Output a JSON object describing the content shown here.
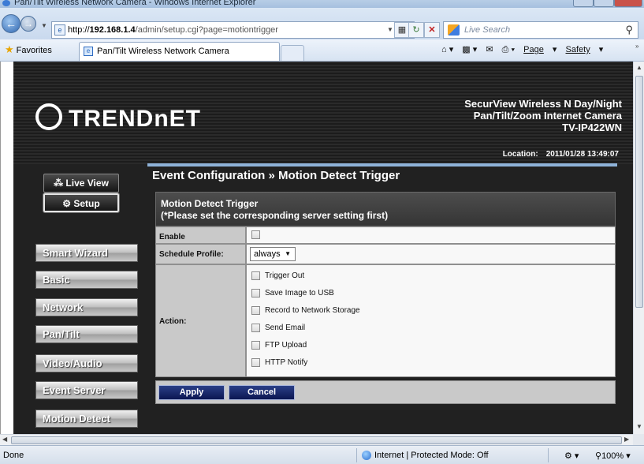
{
  "window": {
    "title": "Pan/Tilt Wireless Network Camera - Windows Internet Explorer"
  },
  "address": {
    "protocol": "http://",
    "host": "192.168.1.4",
    "path": "/admin/setup.cgi?page=motiontrigger"
  },
  "search": {
    "placeholder": "Live Search"
  },
  "favorites": {
    "label": "Favorites"
  },
  "tab": {
    "label": "Pan/Tilt Wireless Network Camera"
  },
  "commandbar": {
    "page": "Page",
    "safety": "Safety"
  },
  "header": {
    "logo": "TRENDnET",
    "product_line1": "SecurView Wireless N Day/Night",
    "product_line2": "Pan/Tilt/Zoom Internet Camera",
    "model": "TV-IP422WN",
    "location_label": "Location:",
    "datetime": "2011/01/28 13:49:07"
  },
  "topbuttons": {
    "liveview": "Live View",
    "setup": "Setup"
  },
  "nav": [
    "Smart Wizard",
    "Basic",
    "Network",
    "Pan/Tilt",
    "Video/Audio",
    "Event Server",
    "Motion Detect"
  ],
  "event": {
    "title": "Event Configuration » Motion Detect Trigger",
    "section_title": "Motion Detect Trigger",
    "section_note": "(*Please set the corresponding server setting first)",
    "enable_label": "Enable",
    "enable_checked": false,
    "schedule_label": "Schedule Profile:",
    "schedule_value": "always",
    "action_label": "Action:",
    "actions": [
      {
        "label": "Trigger Out",
        "checked": false
      },
      {
        "label": "Save Image to USB",
        "checked": false
      },
      {
        "label": "Record to Network Storage",
        "checked": false
      },
      {
        "label": "Send Email",
        "checked": false
      },
      {
        "label": "FTP Upload",
        "checked": false
      },
      {
        "label": "HTTP Notify",
        "checked": false
      }
    ],
    "apply": "Apply",
    "cancel": "Cancel"
  },
  "status": {
    "done": "Done",
    "zone": "Internet | Protected Mode: Off",
    "zoom": "100%"
  }
}
